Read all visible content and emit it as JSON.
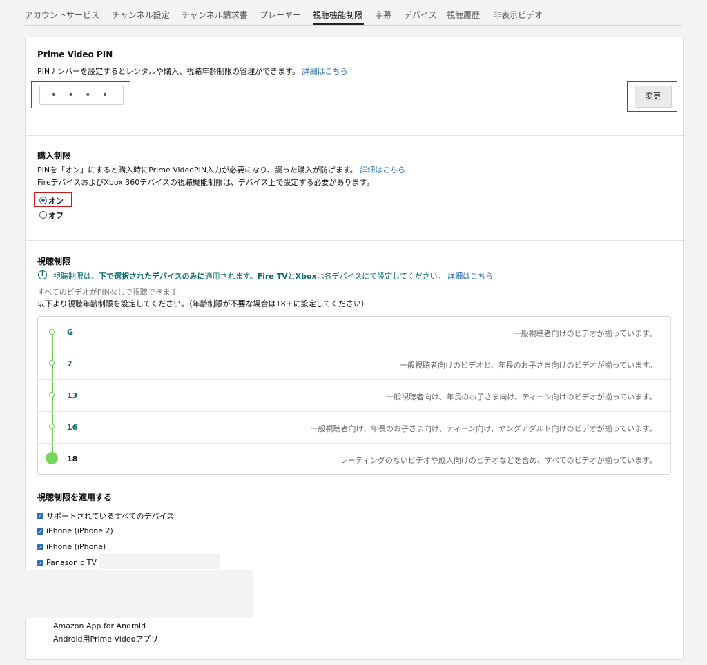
{
  "tabs": [
    {
      "label": "アカウントサービス"
    },
    {
      "label": "チャンネル設定"
    },
    {
      "label": "チャンネル請求書"
    },
    {
      "label": "プレーヤー"
    },
    {
      "label": "視聴機能制限"
    },
    {
      "label": "字幕"
    },
    {
      "label": "デバイス"
    },
    {
      "label": "視聴履歴"
    },
    {
      "label": "非表示ビデオ"
    }
  ],
  "active_tab": "視聴機能制限",
  "pin": {
    "title": "Prime Video PIN",
    "description": "PINナンバーを設定するとレンタルや購入、視聴年齢制限の管理ができます。",
    "link": "詳細はこちら",
    "value": "• • • •",
    "change_button": "変更"
  },
  "purchase": {
    "title": "購入制限",
    "description1": "PINを「オン」にすると購入時にPrime VideoPIN入力が必要になり、誤った購入が防げます。",
    "link": "詳細はこちら",
    "description2": "FireデバイスおよびXbox 360デバイスの視聴機能制限は、デバイス上で設定する必要があります。",
    "options": [
      {
        "label": "オン",
        "selected": true
      },
      {
        "label": "オフ",
        "selected": false
      }
    ]
  },
  "viewing": {
    "title": "視聴制限",
    "info_part1": "視聴制限は、",
    "info_bold1": "下で選択されたデバイスのみに",
    "info_part2": "適用されます。",
    "info_bold2": "Fire TV",
    "info_part3": "と",
    "info_bold3": "Xbox",
    "info_part4": "は各デバイスにて設定してください。",
    "info_link": "詳細はこちら",
    "note": "すべてのビデオがPINなしで視聴できます",
    "instruction": "以下より視聴年齢制限を設定してください。（年齢制限が不要な場合は18＋に設定してください）",
    "ratings": [
      {
        "label": "G",
        "desc": "一般視聴者向けのビデオが揃っています。"
      },
      {
        "label": "7",
        "desc": "一般視聴者向けのビデオと、年長のお子さま向けのビデオが揃っています。"
      },
      {
        "label": "13",
        "desc": "一般視聴者向け、年長のお子さま向け、ティーン向けのビデオが揃っています。"
      },
      {
        "label": "16",
        "desc": "一般視聴者向け、年長のお子さま向け、ティーン向け、ヤングアダルト向けのビデオが揃っています。"
      },
      {
        "label": "18",
        "desc": "レーティングのないビデオや成人向けのビデオなどを含め、すべてのビデオが揃っています。"
      }
    ],
    "selected_rating": "18"
  },
  "apply": {
    "title": "視聴制限を適用する",
    "devices": [
      {
        "label": "サポートされているすべてのデバイス",
        "checked": true
      },
      {
        "label": "iPhone (iPhone 2)",
        "checked": true
      },
      {
        "label": "iPhone (iPhone)",
        "checked": true
      },
      {
        "label": "Panasonic TV",
        "checked": true
      }
    ],
    "extra_devices": [
      "Amazon App for Android",
      "Android用Prime Videoアプリ"
    ]
  },
  "colors": {
    "accent_green": "#7ac74f",
    "link_blue": "#2a6fb0",
    "teal": "#0a6b6b",
    "highlight_red": "#d0191c"
  }
}
